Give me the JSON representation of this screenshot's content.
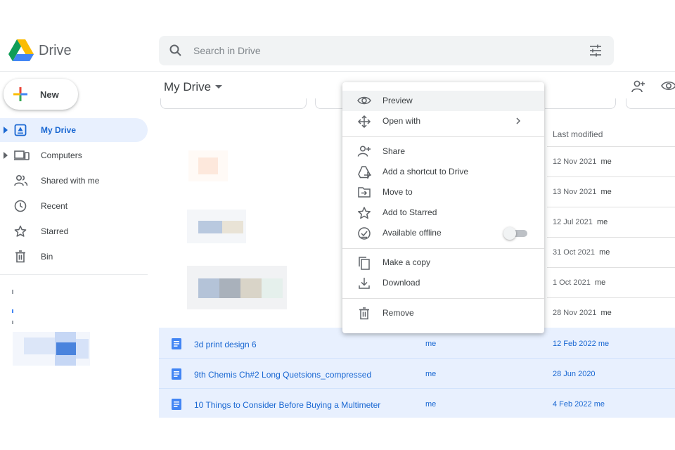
{
  "app": {
    "name": "Drive"
  },
  "search": {
    "placeholder": "Search in Drive"
  },
  "sidebar": {
    "new_label": "New",
    "items": [
      {
        "label": "My Drive",
        "icon": "my-drive-icon",
        "active": true
      },
      {
        "label": "Computers",
        "icon": "computers-icon"
      },
      {
        "label": "Shared with me",
        "icon": "people-icon"
      },
      {
        "label": "Recent",
        "icon": "clock-icon"
      },
      {
        "label": "Starred",
        "icon": "star-icon"
      },
      {
        "label": "Bin",
        "icon": "trash-icon"
      }
    ]
  },
  "main": {
    "breadcrumb": "My Drive",
    "columns": {
      "last_modified": "Last modified"
    },
    "dates": [
      {
        "date": "12 Nov 2021",
        "owner": "me"
      },
      {
        "date": "13 Nov 2021",
        "owner": "me"
      },
      {
        "date": "12 Jul 2021",
        "owner": "me"
      },
      {
        "date": "31 Oct 2021",
        "owner": "me"
      },
      {
        "date": "1 Oct 2021",
        "owner": "me"
      },
      {
        "date": "28 Nov 2021",
        "owner": "me"
      }
    ],
    "files": [
      {
        "name": "3d print design 6",
        "owner": "me",
        "modified": "12 Feb 2022 me"
      },
      {
        "name": "9th Chemis Ch#2 Long Quetsions_compressed",
        "owner": "me",
        "modified": "28 Jun 2020"
      },
      {
        "name": "10 Things to Consider Before Buying a Multimeter",
        "owner": "me",
        "modified": "4 Feb 2022 me"
      }
    ]
  },
  "context_menu": {
    "items": [
      {
        "label": "Preview",
        "icon": "eye-icon"
      },
      {
        "label": "Open with",
        "icon": "move-arrows-icon",
        "submenu": true
      },
      {
        "label": "Share",
        "icon": "person-add-icon"
      },
      {
        "label": "Add a shortcut to Drive",
        "icon": "add-shortcut-icon"
      },
      {
        "label": "Move to",
        "icon": "move-to-folder-icon"
      },
      {
        "label": "Add to Starred",
        "icon": "star-icon"
      },
      {
        "label": "Available offline",
        "icon": "offline-check-icon",
        "toggle": false
      },
      {
        "label": "Make a copy",
        "icon": "copy-icon"
      },
      {
        "label": "Download",
        "icon": "download-icon"
      },
      {
        "label": "Remove",
        "icon": "trash-icon"
      }
    ]
  },
  "colors": {
    "accent_blue": "#1967d2",
    "selected_row": "#e8f0fe",
    "search_bg": "#f1f3f4",
    "menu_hover": "#f1f3f4"
  }
}
